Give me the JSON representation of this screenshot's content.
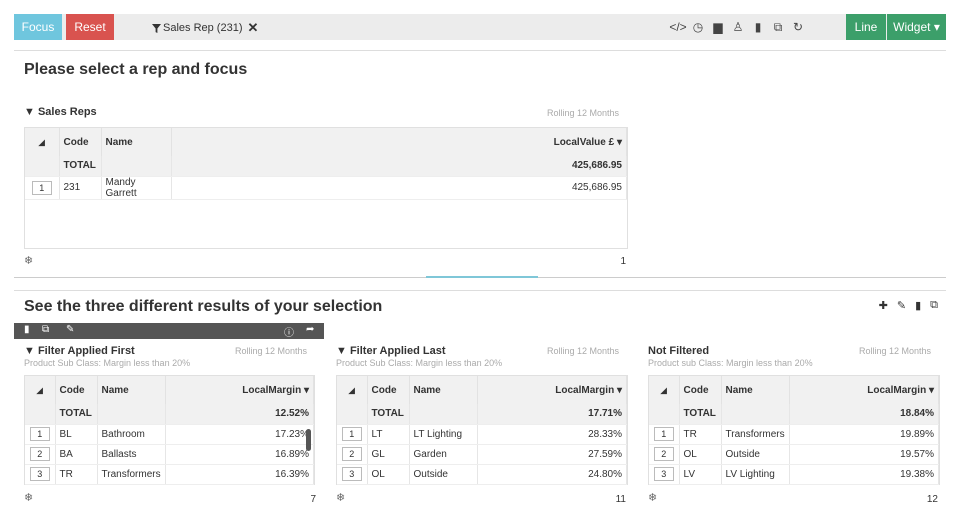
{
  "toolbar": {
    "focus_label": "Focus",
    "reset_label": "Reset",
    "filter_tag": "Sales Rep (231)",
    "line_label": "Line",
    "widget_label": "Widget ▾",
    "icons": [
      "code-icon",
      "clock-icon",
      "print-icon",
      "users-icon",
      "trash-icon",
      "copy-icon",
      "refresh-icon"
    ]
  },
  "top_panel": {
    "title": "Please select a rep and focus",
    "grid_title": "Sales Reps",
    "rolling": "Rolling 12 Months",
    "columns": [
      "Code",
      "Name",
      "LocalValue £"
    ],
    "total": {
      "code": "TOTAL",
      "value": "425,686.95"
    },
    "rows": [
      {
        "no": "1",
        "code": "231",
        "name": "Mandy Garrett",
        "value": "425,686.95"
      }
    ],
    "count": "1"
  },
  "bottom_panel": {
    "title": "See the three different results of your selection",
    "grids": [
      {
        "title": "Filter Applied First",
        "note": "Product Sub Class: Margin less than 20%",
        "rolling": "Rolling 12 Months",
        "columns": [
          "Code",
          "Name",
          "LocalMargin"
        ],
        "total": {
          "code": "TOTAL",
          "value": "12.52%"
        },
        "rows": [
          {
            "no": "1",
            "code": "BL",
            "name": "Bathroom",
            "value": "17.23%"
          },
          {
            "no": "2",
            "code": "BA",
            "name": "Ballasts",
            "value": "16.89%"
          },
          {
            "no": "3",
            "code": "TR",
            "name": "Transformers",
            "value": "16.39%"
          }
        ],
        "count": "7"
      },
      {
        "title": "Filter Applied Last",
        "note": "Product Sub Class: Margin less than 20%",
        "rolling": "Rolling 12 Months",
        "columns": [
          "Code",
          "Name",
          "LocalMargin"
        ],
        "total": {
          "code": "TOTAL",
          "value": "17.71%"
        },
        "rows": [
          {
            "no": "1",
            "code": "LT",
            "name": "LT Lighting",
            "value": "28.33%"
          },
          {
            "no": "2",
            "code": "GL",
            "name": "Garden",
            "value": "27.59%"
          },
          {
            "no": "3",
            "code": "OL",
            "name": "Outside",
            "value": "24.80%"
          }
        ],
        "count": "11"
      },
      {
        "title": "Not Filtered",
        "note": "Product sub Class: Margin less than 20%",
        "rolling": "Rolling 12 Months",
        "columns": [
          "Code",
          "Name",
          "LocalMargin"
        ],
        "total": {
          "code": "TOTAL",
          "value": "18.84%"
        },
        "rows": [
          {
            "no": "1",
            "code": "TR",
            "name": "Transformers",
            "value": "19.89%"
          },
          {
            "no": "2",
            "code": "OL",
            "name": "Outside",
            "value": "19.57%"
          },
          {
            "no": "3",
            "code": "LV",
            "name": "LV Lighting",
            "value": "19.38%"
          }
        ],
        "count": "12"
      }
    ]
  }
}
